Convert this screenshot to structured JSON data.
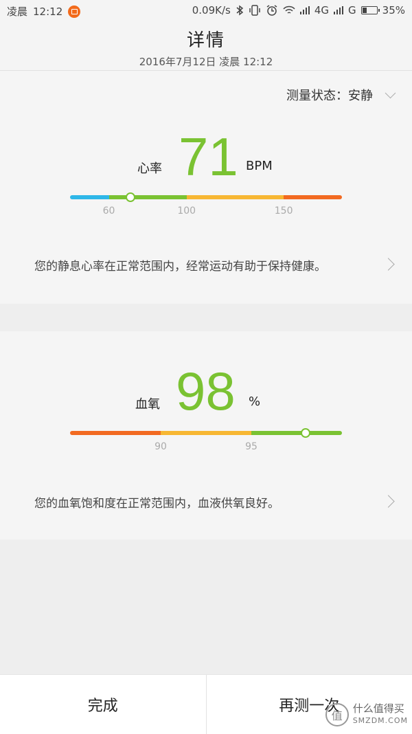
{
  "status_bar": {
    "time_of_day": "凌晨",
    "time": "12:12",
    "network_speed": "0.09K/s",
    "signal1": "4G",
    "signal2": "G",
    "battery_percent": "35%",
    "battery_level": 0.35
  },
  "header": {
    "title": "详情",
    "subtitle": "2016年7月12日 凌晨 12:12"
  },
  "heart_rate": {
    "state_label": "测量状态：安静",
    "label": "心率",
    "value": "71",
    "unit": "BPM",
    "value_color": "#7ac232",
    "scale": {
      "min": 40,
      "max": 180,
      "marker_value": 71,
      "segments": [
        {
          "from": 40,
          "to": 60,
          "color": "#2eb7e8"
        },
        {
          "from": 60,
          "to": 100,
          "color": "#7ac232"
        },
        {
          "from": 100,
          "to": 150,
          "color": "#f7b733"
        },
        {
          "from": 150,
          "to": 180,
          "color": "#f26a21"
        }
      ],
      "ticks": [
        {
          "value": 60,
          "label": "60"
        },
        {
          "value": 100,
          "label": "100"
        },
        {
          "value": 150,
          "label": "150"
        }
      ]
    },
    "description": "您的静息心率在正常范围内，经常运动有助于保持健康。"
  },
  "blood_oxygen": {
    "label": "血氧",
    "value": "98",
    "unit": "%",
    "value_color": "#7ac232",
    "scale": {
      "min": 85,
      "max": 100,
      "marker_value": 98,
      "segments": [
        {
          "from": 85,
          "to": 90,
          "color": "#f26a21"
        },
        {
          "from": 90,
          "to": 95,
          "color": "#f7b733"
        },
        {
          "from": 95,
          "to": 100,
          "color": "#7ac232"
        }
      ],
      "ticks": [
        {
          "value": 90,
          "label": "90"
        },
        {
          "value": 95,
          "label": "95"
        }
      ]
    },
    "description": "您的血氧饱和度在正常范围内，血液供氧良好。"
  },
  "buttons": {
    "done": "完成",
    "retest": "再测一次"
  },
  "watermark": {
    "icon": "值",
    "cn": "什么值得买",
    "en": "SMZDM.COM"
  }
}
